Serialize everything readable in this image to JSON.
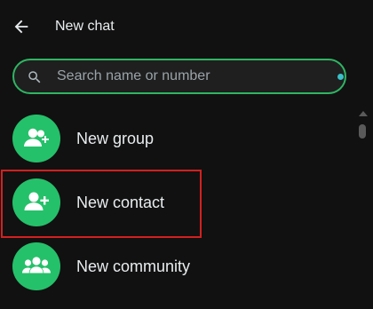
{
  "header": {
    "title": "New chat"
  },
  "search": {
    "placeholder": "Search name or number",
    "value": ""
  },
  "actions": [
    {
      "label": "New group",
      "icon": "group-add-icon"
    },
    {
      "label": "New contact",
      "icon": "person-add-icon"
    },
    {
      "label": "New community",
      "icon": "community-icon"
    }
  ],
  "colors": {
    "accent_green": "#25c16a",
    "search_border": "#2fb563",
    "highlight_red": "#d32020",
    "background": "#111111",
    "text": "#e9edef"
  }
}
